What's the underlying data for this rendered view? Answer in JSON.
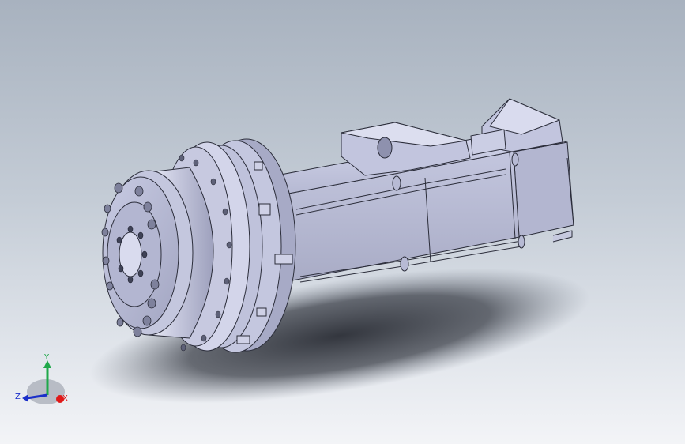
{
  "viewport": {
    "background_top": "#a8b2bf",
    "background_bottom": "#f3f4f7"
  },
  "model": {
    "kind": "servo motor with planetary gearbox (3D CAD assembly)",
    "body_color": "#b9bdd6",
    "edge_color": "#2b2d3a"
  },
  "triad": {
    "y_label": "Y",
    "z_label": "Z",
    "x_label": "X",
    "y_color": "#1fa84a",
    "z_color": "#1b2fc9",
    "x_color": "#e01818"
  }
}
